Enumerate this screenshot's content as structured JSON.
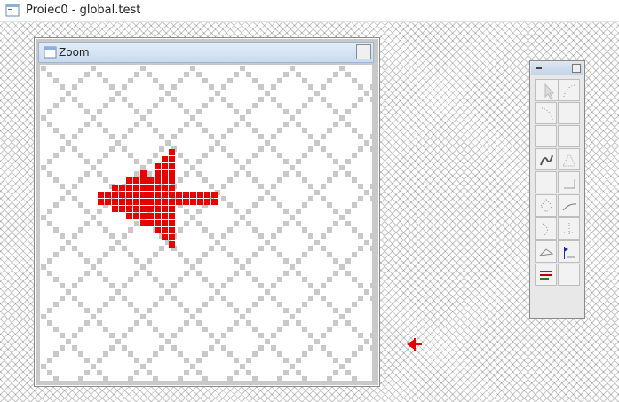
{
  "window": {
    "title": "Proiec0 - global.test"
  },
  "zoom_window": {
    "title": "Zoom"
  },
  "colors": {
    "accent": "#e60000",
    "grid": "#c8c8c8",
    "window_frame": "#c9c9c9"
  },
  "toolbox": {
    "icons": [
      "pointer-icon",
      "arc-left-icon",
      "arc-right-icon",
      "blank-tool-icon",
      "blank-tool-icon",
      "blank-tool-icon",
      "spline-icon",
      "triangle-icon",
      "blank-tool-icon",
      "corner-icon",
      "dotted-shape-icon",
      "curve-icon",
      "dotted-curve-icon",
      "axis-icon",
      "skew-icon",
      "flag-icon",
      "text-lines-icon",
      "blank-tool-icon"
    ]
  }
}
